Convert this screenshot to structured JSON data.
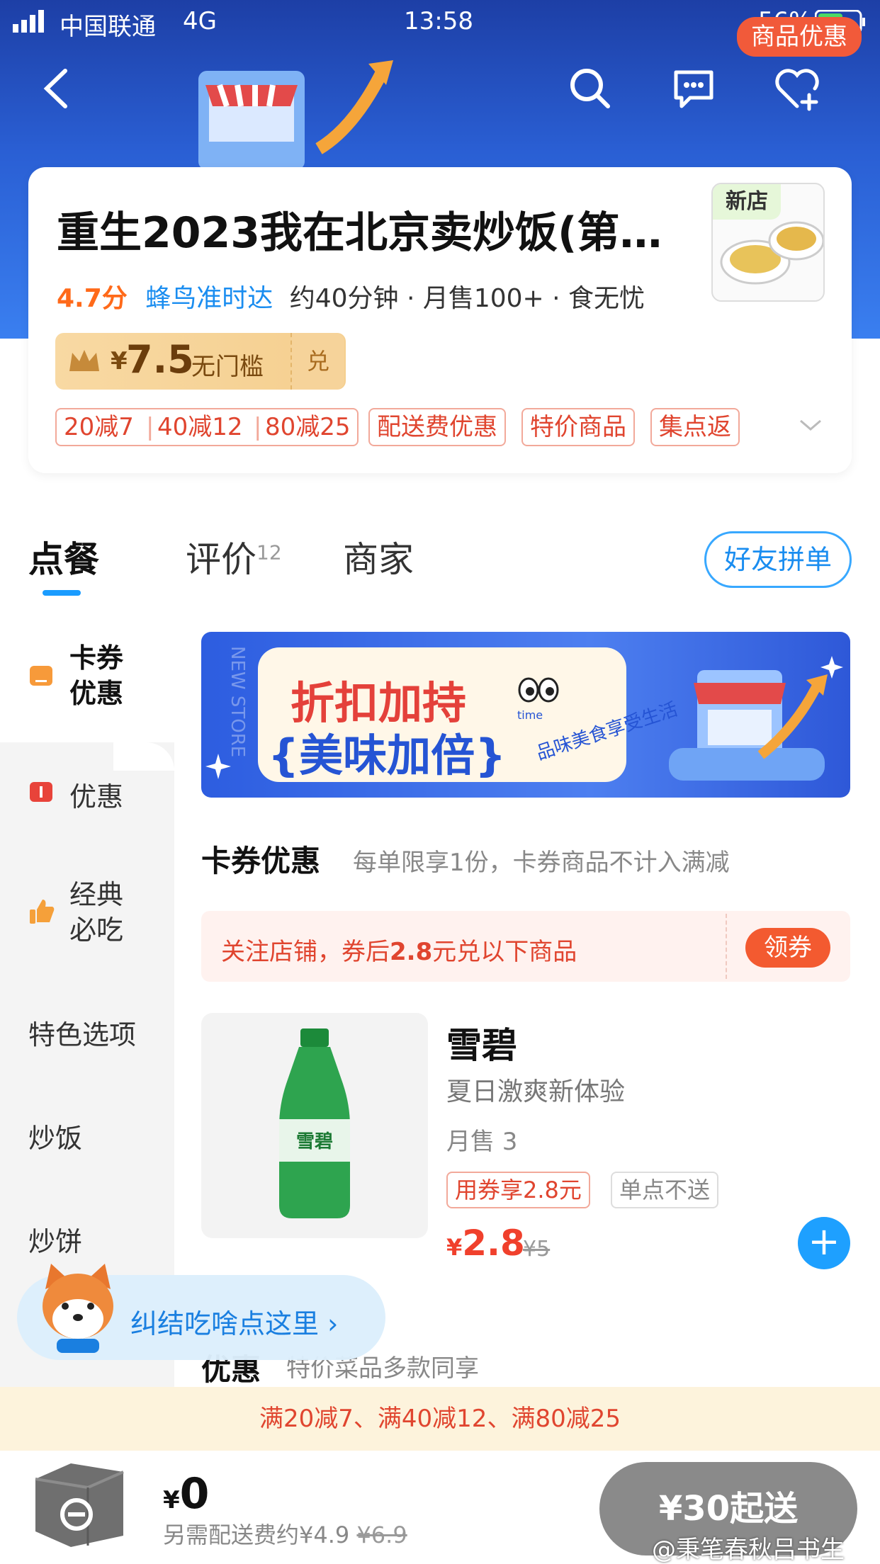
{
  "status_bar": {
    "carrier": "中国联通",
    "network": "4G",
    "time": "13:58",
    "battery": "56%"
  },
  "header": {
    "badge": "商品优惠"
  },
  "store": {
    "name": "重生2023我在北京卖炒饭(第…",
    "new_tag": "新店",
    "rating": "4.7分",
    "delivery": "蜂鸟准时达",
    "meta": "约40分钟 · 月售100+ · 食无忧"
  },
  "coupon": {
    "currency": "¥",
    "amount": "7.5",
    "threshold": "无门槛",
    "exchange": "兑"
  },
  "tags": [
    "20减7",
    "40减12",
    "80减25",
    "配送费优惠",
    "特价商品",
    "集点返"
  ],
  "tabs": {
    "order": "点餐",
    "reviews": "评价",
    "reviews_count": "12",
    "merchant": "商家",
    "group_order": "好友拼单"
  },
  "sidebar": [
    {
      "label": "卡券\n优惠"
    },
    {
      "label": "优惠"
    },
    {
      "label": "经典\n必吃"
    },
    {
      "label": "特色选项"
    },
    {
      "label": "炒饭"
    },
    {
      "label": "炒饼"
    }
  ],
  "banner": {
    "line1": "折扣加持",
    "line2": "{美味加倍}",
    "slogan": "品味美食享受生活",
    "small": "time",
    "side_text": "NEW STORE"
  },
  "section_coupon": {
    "title": "卡券优惠",
    "subtitle": "每单限享1份，卡券商品不计入满减"
  },
  "notice": {
    "prefix": "关注店铺，券后",
    "value": "2.8",
    "suffix": "元兑以下商品",
    "button": "领券"
  },
  "product": {
    "name": "雪碧",
    "desc": "夏日激爽新体验",
    "sales": "月售 3",
    "tag1": "用券享2.8元",
    "tag2": "单点不送",
    "currency": "¥",
    "price": "2.8",
    "old_price": "¥5",
    "add": "+"
  },
  "floating": {
    "text": "纠结吃啥点这里 ›"
  },
  "section_discount": {
    "title": "优惠",
    "subtitle": "特价菜品多款同享"
  },
  "promo_bar": {
    "text": "满20减7、满40减12、满80减25"
  },
  "bottom": {
    "currency": "¥",
    "amount": "0",
    "fee_prefix": "另需配送费约¥4.9",
    "fee_old": "¥6.9",
    "checkout": "¥30起送"
  },
  "watermark": "@秉笔春秋吕书生",
  "colors": {
    "accent": "#1ea0ff",
    "price": "#f0402c",
    "header": "#2a5fd4"
  }
}
